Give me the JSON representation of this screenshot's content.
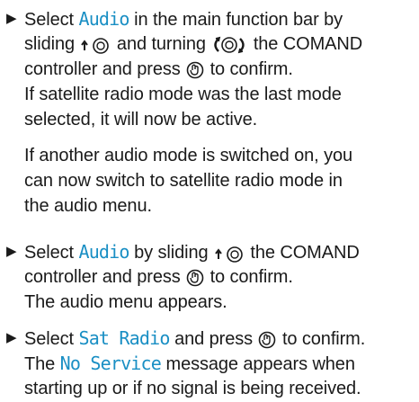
{
  "instructions": {
    "step1": {
      "line1_a": "Select ",
      "line1_hl": "Audio",
      "line1_b": " in the main function bar by",
      "line2_a": "sliding ",
      "line2_b": " and turning ",
      "line2_c": " the COMAND",
      "line3_a": "controller and press ",
      "line3_b": " to confirm.",
      "line4": "If satellite radio mode was the last mode",
      "line5": "selected, it will now be active.",
      "line6": "If another audio mode is switched on, you",
      "line7": "can now switch to satellite radio mode in",
      "line8": "the audio menu."
    },
    "step2": {
      "line1_a": "Select ",
      "line1_hl": "Audio",
      "line1_b": " by sliding ",
      "line1_c": " the COMAND",
      "line2_a": "controller and press ",
      "line2_b": " to confirm.",
      "line3": "The audio menu appears."
    },
    "step3": {
      "line1_a": "Select ",
      "line1_hl": "Sat Radio",
      "line1_b": " and press ",
      "line1_c": " to confirm.",
      "line2_a": "The ",
      "line2_hl": "No Service",
      "line2_b": " message appears when",
      "line3": "starting up or if no signal is being received."
    }
  },
  "icons": {
    "bullet": "triangle-right-bullet-icon",
    "slide": "slide-up-controller-icon",
    "turn": "turn-controller-icon",
    "press": "press-controller-icon"
  },
  "colors": {
    "highlight": "#1a8fc4",
    "text": "#1a1a1a"
  }
}
